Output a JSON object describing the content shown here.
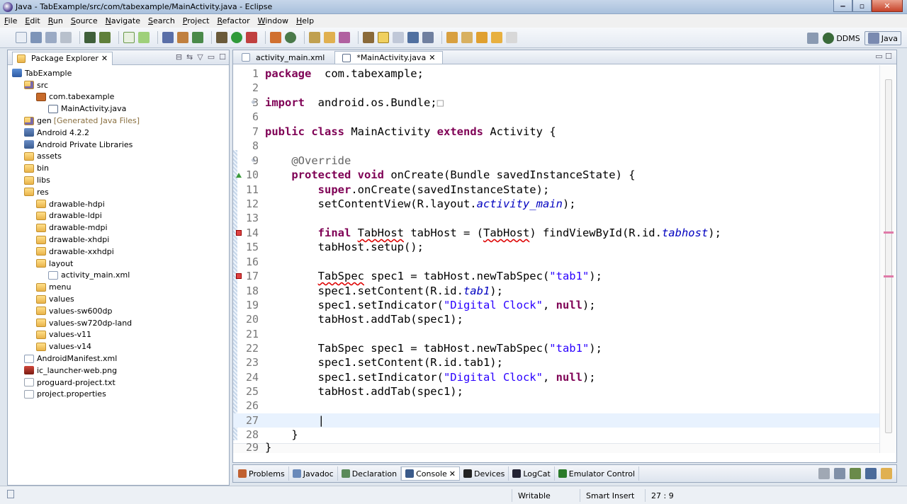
{
  "window": {
    "title": "Java - TabExample/src/com/tabexample/MainActivity.java - Eclipse"
  },
  "menu": [
    "File",
    "Edit",
    "Run",
    "Source",
    "Navigate",
    "Search",
    "Project",
    "Refactor",
    "Window",
    "Help"
  ],
  "perspectives": {
    "ddms": "DDMS",
    "java": "Java"
  },
  "package_explorer": {
    "title": "Package Explorer",
    "items": [
      {
        "label": "TabExample",
        "indent": 0,
        "icon": "project"
      },
      {
        "label": "src",
        "indent": 1,
        "icon": "src"
      },
      {
        "label": "com.tabexample",
        "indent": 2,
        "icon": "pkg"
      },
      {
        "label": "MainActivity.java",
        "indent": 3,
        "icon": "java"
      },
      {
        "label": "gen",
        "indent": 1,
        "icon": "src",
        "note": "[Generated Java Files]"
      },
      {
        "label": "Android 4.2.2",
        "indent": 1,
        "icon": "lib"
      },
      {
        "label": "Android Private Libraries",
        "indent": 1,
        "icon": "lib"
      },
      {
        "label": "assets",
        "indent": 1,
        "icon": "folder"
      },
      {
        "label": "bin",
        "indent": 1,
        "icon": "folder"
      },
      {
        "label": "libs",
        "indent": 1,
        "icon": "folder"
      },
      {
        "label": "res",
        "indent": 1,
        "icon": "folder"
      },
      {
        "label": "drawable-hdpi",
        "indent": 2,
        "icon": "folder"
      },
      {
        "label": "drawable-ldpi",
        "indent": 2,
        "icon": "folder"
      },
      {
        "label": "drawable-mdpi",
        "indent": 2,
        "icon": "folder"
      },
      {
        "label": "drawable-xhdpi",
        "indent": 2,
        "icon": "folder"
      },
      {
        "label": "drawable-xxhdpi",
        "indent": 2,
        "icon": "folder"
      },
      {
        "label": "layout",
        "indent": 2,
        "icon": "folder"
      },
      {
        "label": "activity_main.xml",
        "indent": 3,
        "icon": "xml"
      },
      {
        "label": "menu",
        "indent": 2,
        "icon": "folder"
      },
      {
        "label": "values",
        "indent": 2,
        "icon": "folder"
      },
      {
        "label": "values-sw600dp",
        "indent": 2,
        "icon": "folder"
      },
      {
        "label": "values-sw720dp-land",
        "indent": 2,
        "icon": "folder"
      },
      {
        "label": "values-v11",
        "indent": 2,
        "icon": "folder"
      },
      {
        "label": "values-v14",
        "indent": 2,
        "icon": "folder"
      },
      {
        "label": "AndroidManifest.xml",
        "indent": 1,
        "icon": "xml"
      },
      {
        "label": "ic_launcher-web.png",
        "indent": 1,
        "icon": "png"
      },
      {
        "label": "proguard-project.txt",
        "indent": 1,
        "icon": "txt"
      },
      {
        "label": "project.properties",
        "indent": 1,
        "icon": "txt"
      }
    ]
  },
  "editor": {
    "tabs": [
      {
        "label": "activity_main.xml",
        "active": false
      },
      {
        "label": "*MainActivity.java",
        "active": true
      }
    ],
    "lines": [
      {
        "n": "1",
        "parts": [
          [
            "kw",
            "package"
          ],
          [
            "",
            "  com.tabexample;"
          ]
        ]
      },
      {
        "n": "2",
        "parts": []
      },
      {
        "n": "3",
        "parts": [
          [
            "kw",
            "import"
          ],
          [
            "",
            "  android.os.Bundle;"
          ],
          [
            "box",
            "□"
          ]
        ],
        "fold": "⊕"
      },
      {
        "n": "6",
        "parts": []
      },
      {
        "n": "7",
        "parts": [
          [
            "kw",
            "public"
          ],
          [
            "",
            " "
          ],
          [
            "kw",
            "class"
          ],
          [
            "",
            " MainActivity "
          ],
          [
            "kw",
            "extends"
          ],
          [
            "",
            " Activity {"
          ]
        ]
      },
      {
        "n": "8",
        "parts": []
      },
      {
        "n": "9",
        "parts": [
          [
            "",
            "    "
          ],
          [
            "anno",
            "@Override"
          ]
        ],
        "fold": "⊖"
      },
      {
        "n": "10",
        "parts": [
          [
            "",
            "    "
          ],
          [
            "kw",
            "protected"
          ],
          [
            "",
            " "
          ],
          [
            "kw",
            "void"
          ],
          [
            "",
            " onCreate(Bundle savedInstanceState) {"
          ]
        ],
        "marker": "ovr"
      },
      {
        "n": "11",
        "parts": [
          [
            "",
            "        "
          ],
          [
            "kw",
            "super"
          ],
          [
            "",
            ".onCreate(savedInstanceState);"
          ]
        ]
      },
      {
        "n": "12",
        "parts": [
          [
            "",
            "        setContentView(R.layout."
          ],
          [
            "ital",
            "activity_main"
          ],
          [
            "",
            ");"
          ]
        ]
      },
      {
        "n": "13",
        "parts": []
      },
      {
        "n": "14",
        "parts": [
          [
            "",
            "        "
          ],
          [
            "kw",
            "final"
          ],
          [
            "",
            " "
          ],
          [
            "err",
            "TabHost"
          ],
          [
            "",
            " tabHost = ("
          ],
          [
            "err",
            "TabHost"
          ],
          [
            "",
            ") findViewById(R.id."
          ],
          [
            "ital",
            "tabhost"
          ],
          [
            "",
            ");"
          ]
        ],
        "marker": "err"
      },
      {
        "n": "15",
        "parts": [
          [
            "",
            "        tabHost.setup();"
          ]
        ]
      },
      {
        "n": "16",
        "parts": []
      },
      {
        "n": "17",
        "parts": [
          [
            "",
            "        "
          ],
          [
            "err",
            "TabSpec"
          ],
          [
            "",
            " spec1 = tabHost.newTabSpec("
          ],
          [
            "str",
            "\"tab1\""
          ],
          [
            "",
            ");"
          ]
        ],
        "marker": "err"
      },
      {
        "n": "18",
        "parts": [
          [
            "",
            "        spec1.setContent(R.id."
          ],
          [
            "ital",
            "tab1"
          ],
          [
            "",
            ");"
          ]
        ]
      },
      {
        "n": "19",
        "parts": [
          [
            "",
            "        spec1.setIndicator("
          ],
          [
            "str",
            "\"Digital Clock\""
          ],
          [
            "",
            ", "
          ],
          [
            "kw",
            "null"
          ],
          [
            "",
            ");"
          ]
        ]
      },
      {
        "n": "20",
        "parts": [
          [
            "",
            "        tabHost.addTab(spec1);"
          ]
        ]
      },
      {
        "n": "21",
        "parts": []
      },
      {
        "n": "22",
        "parts": [
          [
            "",
            "        TabSpec spec1 = tabHost.newTabSpec("
          ],
          [
            "str",
            "\"tab1\""
          ],
          [
            "",
            ");"
          ]
        ]
      },
      {
        "n": "23",
        "parts": [
          [
            "",
            "        spec1.setContent(R.id.tab1);"
          ]
        ]
      },
      {
        "n": "24",
        "parts": [
          [
            "",
            "        spec1.setIndicator("
          ],
          [
            "str",
            "\"Digital Clock\""
          ],
          [
            "",
            ", "
          ],
          [
            "kw",
            "null"
          ],
          [
            "",
            ");"
          ]
        ]
      },
      {
        "n": "25",
        "parts": [
          [
            "",
            "        tabHost.addTab(spec1);"
          ]
        ]
      },
      {
        "n": "26",
        "parts": []
      },
      {
        "n": "27",
        "parts": [
          [
            "",
            "        |"
          ]
        ],
        "current": true
      },
      {
        "n": "28",
        "parts": [
          [
            "",
            "    }"
          ]
        ]
      },
      {
        "n": "29",
        "parts": [
          [
            "",
            "}"
          ]
        ]
      }
    ]
  },
  "bottom_tabs": [
    {
      "label": "Problems",
      "active": false
    },
    {
      "label": "Javadoc",
      "active": false
    },
    {
      "label": "Declaration",
      "active": false
    },
    {
      "label": "Console",
      "active": true
    },
    {
      "label": "Devices",
      "active": false
    },
    {
      "label": "LogCat",
      "active": false
    },
    {
      "label": "Emulator Control",
      "active": false
    }
  ],
  "status": {
    "mode": "Writable",
    "insert": "Smart Insert",
    "position": "27 : 9"
  }
}
